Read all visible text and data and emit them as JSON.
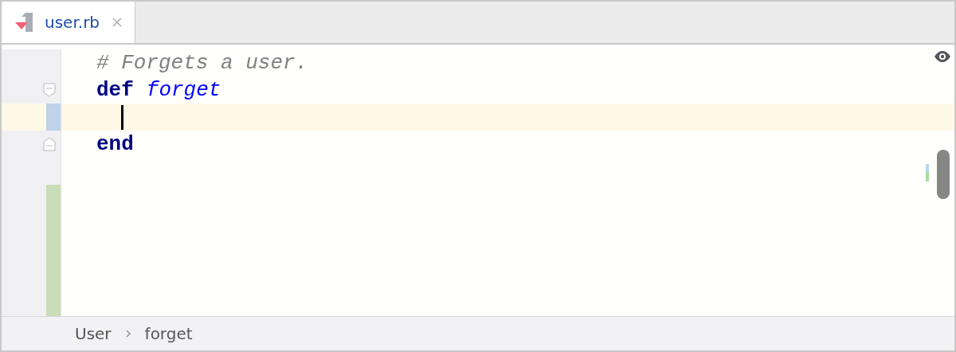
{
  "tabs": [
    {
      "label": "user.rb",
      "selected": true,
      "closable": true
    }
  ],
  "editor": {
    "lines": [
      {
        "tokens": [
          {
            "kind": "comment",
            "text": "# Forgets a user."
          }
        ],
        "fold_start": false,
        "fold_end": false,
        "modified": false,
        "added": false,
        "current": false
      },
      {
        "tokens": [
          {
            "kind": "keyword",
            "text": "def"
          },
          {
            "kind": "method",
            "text": "forget"
          }
        ],
        "fold_start": true,
        "fold_end": false,
        "modified": false,
        "added": false,
        "current": false
      },
      {
        "fold_start": false,
        "fold_end": false,
        "modified": true,
        "added": false,
        "current": true
      },
      {
        "tokens": [
          {
            "kind": "keyword",
            "text": "end"
          }
        ],
        "fold_start": false,
        "fold_end": true,
        "modified": false,
        "added": false,
        "current": false
      },
      {
        "fold_start": false,
        "fold_end": false,
        "modified": false,
        "added": false,
        "current": false
      },
      {
        "fold_start": false,
        "fold_end": false,
        "modified": false,
        "added": true,
        "current": false
      },
      {
        "fold_start": false,
        "fold_end": false,
        "modified": false,
        "added": true,
        "current": false
      },
      {
        "fold_start": false,
        "fold_end": false,
        "modified": false,
        "added": true,
        "current": false
      },
      {
        "fold_start": false,
        "fold_end": false,
        "modified": false,
        "added": true,
        "current": false
      },
      {
        "fold_start": false,
        "fold_end": false,
        "modified": false,
        "added": true,
        "current": false
      }
    ]
  },
  "breadcrumbs": [
    {
      "label": "User"
    },
    {
      "label": "forget"
    }
  ]
}
